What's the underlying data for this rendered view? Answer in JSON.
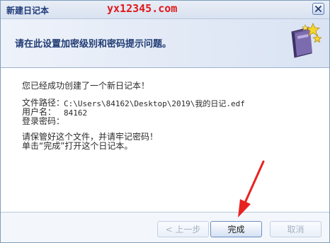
{
  "window": {
    "title": "新建日记本",
    "watermark": "yx12345.com",
    "close_icon": "close-icon"
  },
  "header": {
    "text": "请在此设置加密级别和密码提示问题。",
    "icon": "diary-book-icon"
  },
  "body": {
    "success_message": "您已经成功创建了一个新日记本！",
    "file_path_label": "文件路径：",
    "file_path_value": "C:\\Users\\84162\\Desktop\\2019\\我的日记.edf",
    "username_label": "用户名：",
    "username_value": "84162",
    "password_label": "登录密码：",
    "password_value": "",
    "instruction_line1": "请保管好这个文件，并请牢记密码！",
    "instruction_line2": "单击“完成”打开这个日记本。"
  },
  "footer": {
    "prev_label": "< 上一步",
    "finish_label": "完成",
    "cancel_label": "取消"
  },
  "colors": {
    "watermark": "#e0191b",
    "annotation_arrow": "#e8231f",
    "title_text": "#1e3a78"
  }
}
